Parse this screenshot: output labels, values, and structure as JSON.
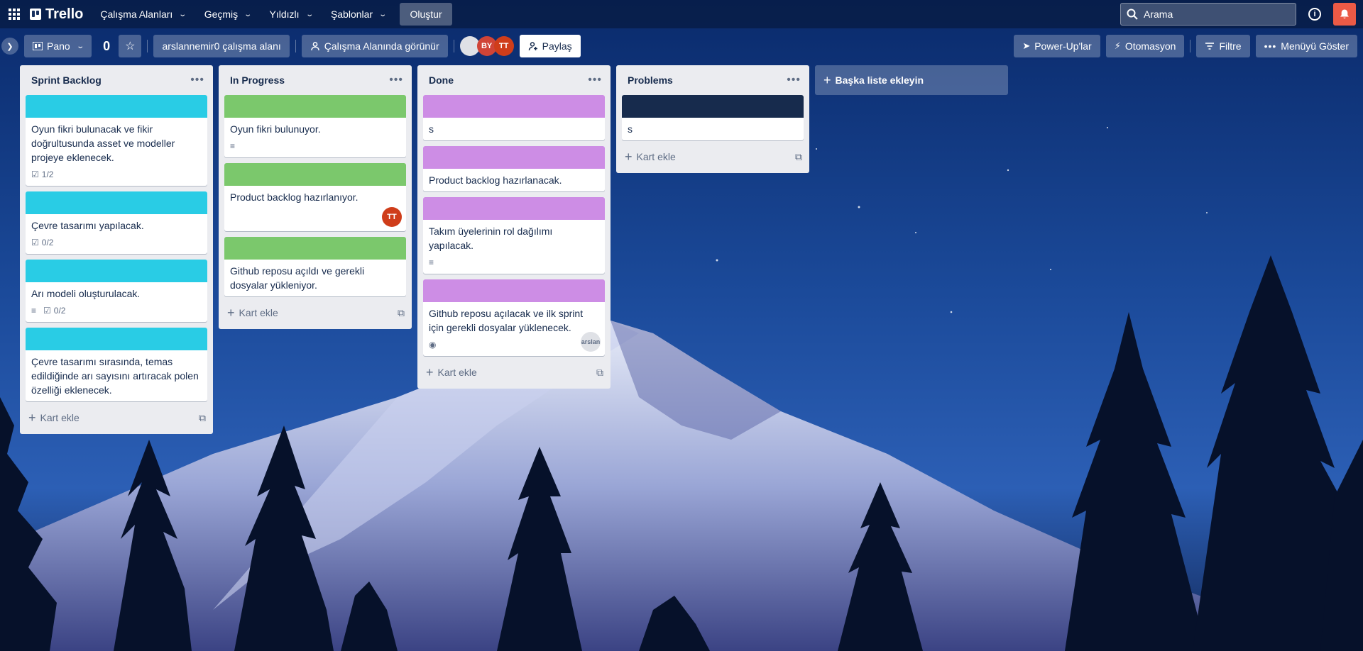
{
  "topnav": {
    "logo": "Trello",
    "items": [
      {
        "label": "Çalışma Alanları"
      },
      {
        "label": "Geçmiş"
      },
      {
        "label": "Yıldızlı"
      },
      {
        "label": "Şablonlar"
      }
    ],
    "create_label": "Oluştur",
    "search_placeholder": "Arama"
  },
  "board": {
    "view_label": "Pano",
    "name": "0",
    "workspace_label": "arslannemir0 çalışma alanı",
    "visibility_label": "Çalışma Alanında görünür",
    "members": [
      "BY",
      "TT"
    ],
    "share_label": "Paylaş",
    "powerups_label": "Power-Up'lar",
    "automation_label": "Otomasyon",
    "filter_label": "Filtre",
    "menu_label": "Menüyü Göster"
  },
  "lists": [
    {
      "title": "Sprint Backlog",
      "cover_color": "#29cce5",
      "add_card": "Kart ekle",
      "cards": [
        {
          "title": "Oyun fikri bulunacak ve fikir doğrultusunda asset ve modeller projeye eklenecek.",
          "checklist": "1/2"
        },
        {
          "title": "Çevre tasarımı yapılacak.",
          "checklist": "0/2"
        },
        {
          "title": "Arı modeli oluşturulacak.",
          "checklist": "0/2",
          "description": true
        },
        {
          "title": "Çevre tasarımı sırasında, temas edildiğinde arı sayısını artıracak polen özelliği eklenecek."
        }
      ]
    },
    {
      "title": "In Progress",
      "cover_color": "#7bc86c",
      "add_card": "Kart ekle",
      "cards": [
        {
          "title": "Oyun fikri bulunuyor.",
          "description": true
        },
        {
          "title": "Product backlog hazırlanıyor.",
          "member": "TT"
        },
        {
          "title": "Github reposu açıldı ve gerekli dosyalar yükleniyor."
        }
      ]
    },
    {
      "title": "Done",
      "cover_color": "#cd8de5",
      "add_card": "Kart ekle",
      "cards": [
        {
          "title": "s"
        },
        {
          "title": "Product backlog hazırlanacak."
        },
        {
          "title": "Takım üyelerinin rol dağılımı yapılacak.",
          "description": true
        },
        {
          "title": "Github reposu açılacak ve ilk sprint için gerekli dosyalar yüklenecek.",
          "watch": true,
          "member_img": "arslan"
        }
      ]
    },
    {
      "title": "Problems",
      "cover_color": "#172b4d",
      "add_card": "Kart ekle",
      "cards": [
        {
          "title": "s"
        }
      ]
    }
  ],
  "add_list_label": "Başka liste ekleyin"
}
